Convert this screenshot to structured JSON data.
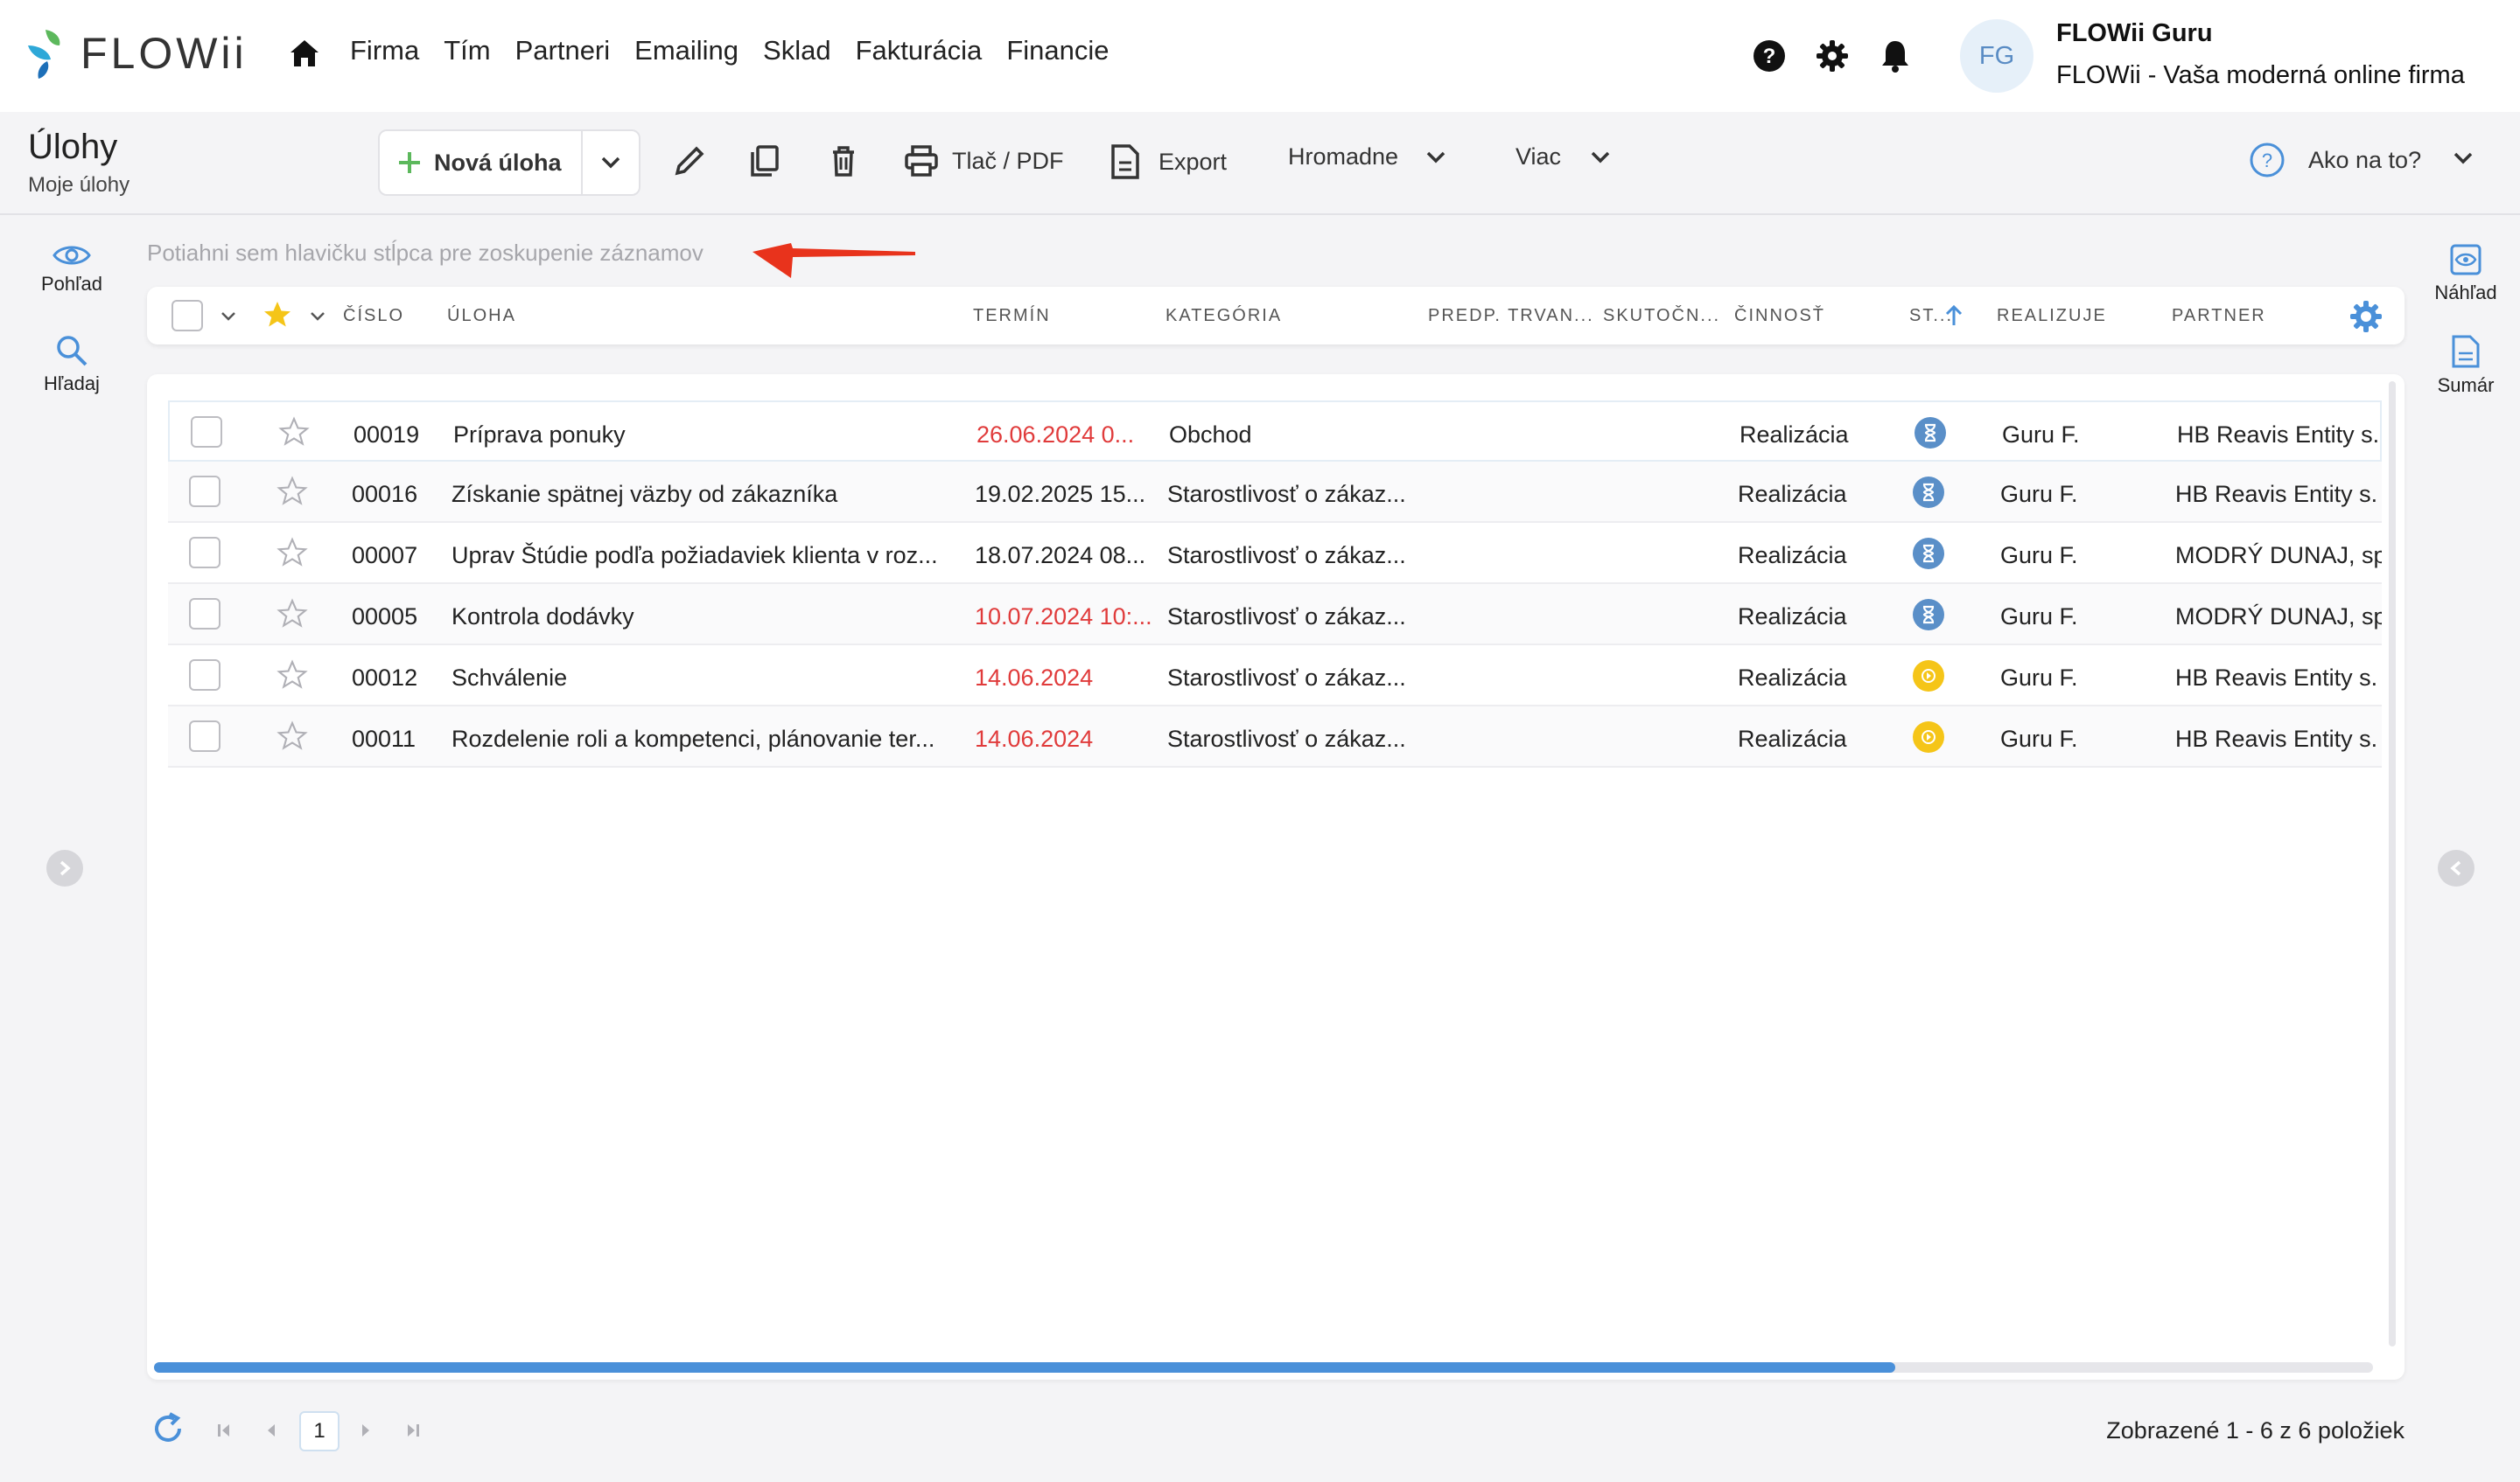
{
  "app": {
    "logo_text": "FLOWii",
    "nav": [
      "Firma",
      "Tím",
      "Partneri",
      "Emailing",
      "Sklad",
      "Fakturácia",
      "Financie"
    ],
    "user": {
      "initials": "FG",
      "name": "FLOWii Guru",
      "company": "FLOWii - Vaša moderná online firma"
    }
  },
  "toolbar": {
    "title": "Úlohy",
    "subtitle": "Moje úlohy",
    "new_label": "Nová úloha",
    "print_label": "Tlač / PDF",
    "export_label": "Export",
    "bulk_label": "Hromadne",
    "more_label": "Viac",
    "help_label": "Ako na to?"
  },
  "left_panel": {
    "view_label": "Pohľad",
    "search_label": "Hľadaj"
  },
  "right_panel": {
    "preview_label": "Náhľad",
    "summary_label": "Sumár"
  },
  "grid": {
    "group_hint": "Potiahni sem hlavičku stĺpca pre zoskupenie záznamov",
    "columns": [
      "ČÍSLO",
      "ÚLOHA",
      "TERMÍN",
      "KATEGÓRIA",
      "PREDP. TRVAN...",
      "SKUTOČN...",
      "ČINNOSŤ",
      "ST...",
      "REALIZUJE",
      "PARTNER"
    ],
    "rows": [
      {
        "num": "00019",
        "task": "Príprava ponuky",
        "due": "26.06.2024 0...",
        "overdue": true,
        "category": "Obchod",
        "activity": "Realizácia",
        "status": "waiting",
        "assignee": "Guru F.",
        "partner": "HB Reavis Entity s."
      },
      {
        "num": "00016",
        "task": "Získanie spätnej väzby od zákazníka",
        "due": "19.02.2025 15...",
        "overdue": false,
        "category": "Starostlivosť o zákaz...",
        "activity": "Realizácia",
        "status": "waiting",
        "assignee": "Guru F.",
        "partner": "HB Reavis Entity s."
      },
      {
        "num": "00007",
        "task": "Uprav Štúdie podľa požiadaviek klienta v roz...",
        "due": "18.07.2024 08...",
        "overdue": false,
        "category": "Starostlivosť o zákaz...",
        "activity": "Realizácia",
        "status": "waiting",
        "assignee": "Guru F.",
        "partner": "MODRÝ DUNAJ, sp"
      },
      {
        "num": "00005",
        "task": "Kontrola dodávky",
        "due": "10.07.2024 10:...",
        "overdue": true,
        "category": "Starostlivosť o zákaz...",
        "activity": "Realizácia",
        "status": "waiting",
        "assignee": "Guru F.",
        "partner": "MODRÝ DUNAJ, sp"
      },
      {
        "num": "00012",
        "task": "Schválenie",
        "due": "14.06.2024",
        "overdue": true,
        "category": "Starostlivosť o zákaz...",
        "activity": "Realizácia",
        "status": "in-progress",
        "assignee": "Guru F.",
        "partner": "HB Reavis Entity s."
      },
      {
        "num": "00011",
        "task": "Rozdelenie roli a kompetenci, plánovanie ter...",
        "due": "14.06.2024",
        "overdue": true,
        "category": "Starostlivosť o zákaz...",
        "activity": "Realizácia",
        "status": "in-progress",
        "assignee": "Guru F.",
        "partner": "HB Reavis Entity s."
      }
    ]
  },
  "footer": {
    "page": "1",
    "info": "Zobrazené 1 - 6 z 6 položiek"
  },
  "colors": {
    "accent": "#4a90d9",
    "overdue": "#e03b3b",
    "status_waiting": "#5a8fc8",
    "status_progress": "#f5c518",
    "add_green": "#5cb85c",
    "arrow_red": "#e8331c"
  }
}
